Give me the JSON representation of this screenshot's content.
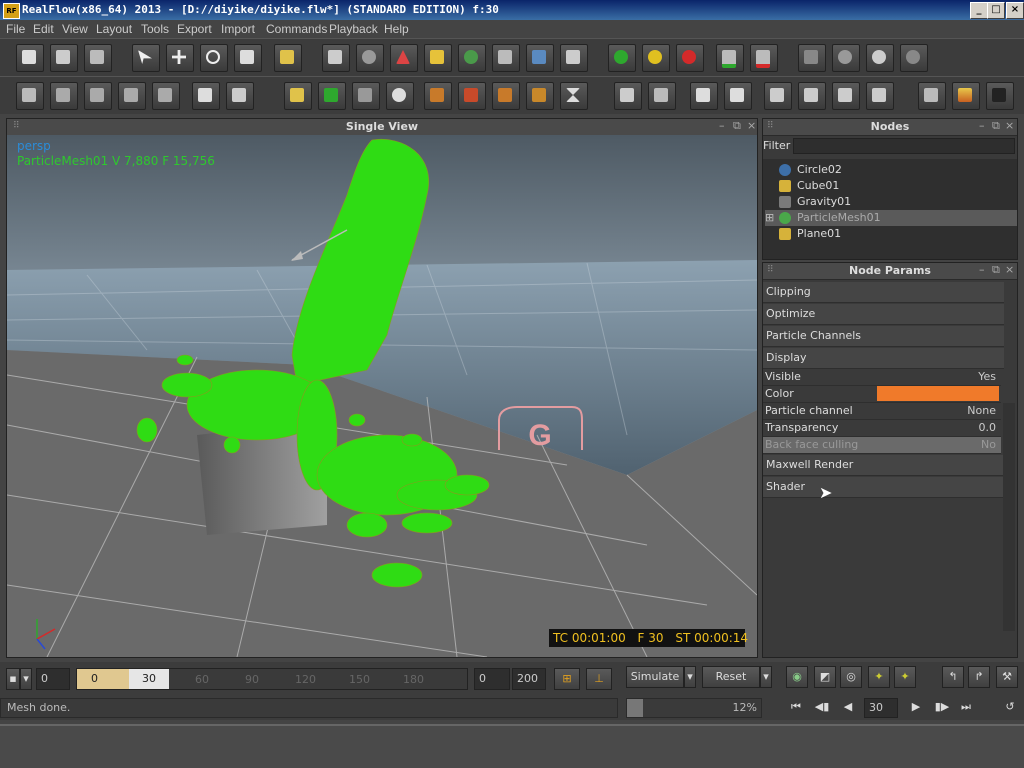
{
  "window": {
    "title": "RealFlow(x86_64) 2013 - [D://diyike/diyike.flw*] (STANDARD EDITION) f:30",
    "app_icon_text": "RF"
  },
  "menu": [
    "File",
    "Edit",
    "View",
    "Layout",
    "Tools",
    "Export",
    "Import",
    "Commands",
    "Playback",
    "Help"
  ],
  "viewport": {
    "title": "Single View",
    "camera": "persp",
    "selection_info": "ParticleMesh01 V 7,880 F 15,756",
    "timecode": "TC 00:01:00",
    "frame": "F 30",
    "sim_time": "ST 00:00:14",
    "gravity_label": "G"
  },
  "nodes": {
    "title": "Nodes",
    "filter_label": "Filter",
    "filter_value": "",
    "items": [
      {
        "label": "Circle02",
        "color": "#3d6fa8"
      },
      {
        "label": "Cube01",
        "color": "#d6b23a"
      },
      {
        "label": "Gravity01",
        "color": "#7a7a7a"
      },
      {
        "label": "ParticleMesh01",
        "color": "#4aa84a"
      },
      {
        "label": "Plane01",
        "color": "#d6b23a"
      }
    ]
  },
  "params": {
    "title": "Node Params",
    "sections_top": [
      "Clipping",
      "Optimize",
      "Particle Channels",
      "Display"
    ],
    "rows": [
      {
        "label": "Visible",
        "value": "Yes"
      },
      {
        "label": "Color",
        "value": ""
      },
      {
        "label": "Particle channel",
        "value": "None"
      },
      {
        "label": "Transparency",
        "value": "0.0"
      },
      {
        "label": "Back face culling",
        "value": "No"
      }
    ],
    "sections_bottom": [
      "Maxwell Render",
      "Shader"
    ],
    "color_swatch": "#f07a2a"
  },
  "timeline": {
    "start": "0",
    "range_start": "0",
    "range_end": "30",
    "ticks": [
      "60",
      "90",
      "120",
      "150",
      "180"
    ],
    "min": "0",
    "max": "200",
    "simulate": "Simulate",
    "reset": "Reset"
  },
  "status": {
    "message": "Mesh done.",
    "progress": "12%",
    "progress_value": 0.12
  },
  "playback": {
    "frame": "30"
  }
}
